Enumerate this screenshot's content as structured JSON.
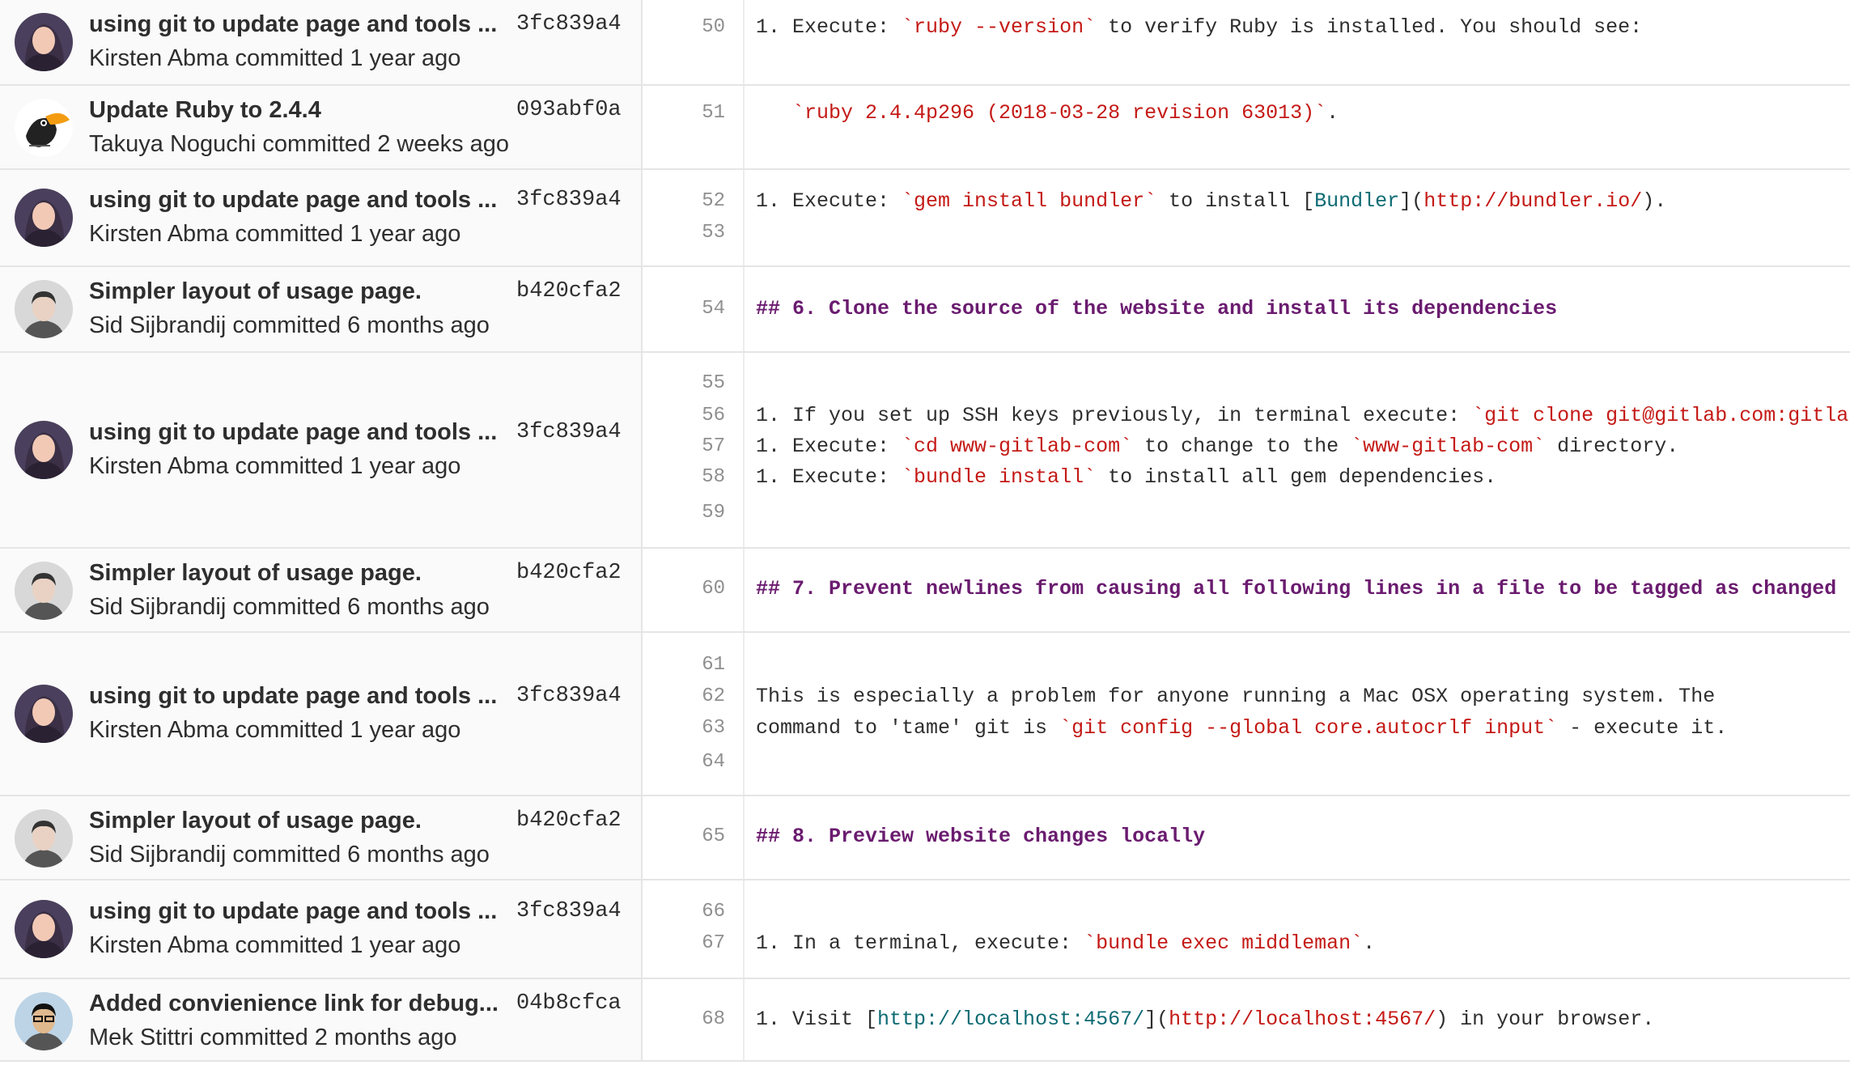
{
  "colors": {
    "text": "#2e2e2e",
    "line_number": "#8f8f8f",
    "string": "#c41a16",
    "link": "#0e6b74",
    "heading": "#6a1b6f",
    "commit_bg": "#fafafa",
    "border": "#e5e5e5"
  },
  "avatars": {
    "kirsten": {
      "icon": "avatar-woman-photo-icon",
      "bg": "#4a3f5c",
      "skin": "#f2c9b5",
      "hair": "#3a2f45"
    },
    "takuya": {
      "icon": "avatar-toucan-icon",
      "bg": "#ffffff",
      "beak": "#f39c12",
      "body": "#222222"
    },
    "sid": {
      "icon": "avatar-man-photo-icon",
      "bg": "#d8d8d8",
      "skin": "#e9d2c3",
      "hair": "#333333"
    },
    "mek": {
      "icon": "avatar-man-glasses-photo-icon",
      "bg": "#bcd4e6",
      "skin": "#e0b98e",
      "hair": "#111111"
    }
  },
  "blocks": [
    {
      "commit": {
        "title": "using git to update page and tools ...",
        "sha": "3fc839a4",
        "author": "Kirsten Abma",
        "committed": "committed",
        "time": "1 year ago",
        "avatar": "kirsten"
      },
      "lines": [
        {
          "no": "50",
          "tokens": [
            {
              "t": "plain",
              "s": "1. Execute: "
            },
            {
              "t": "str",
              "s": "`ruby --version`"
            },
            {
              "t": "plain",
              "s": " to verify Ruby is installed. You should see:"
            }
          ]
        }
      ]
    },
    {
      "commit": {
        "title": "Update Ruby to 2.4.4",
        "sha": "093abf0a",
        "author": "Takuya Noguchi",
        "committed": "committed",
        "time": "2 weeks ago",
        "avatar": "takuya"
      },
      "lines": [
        {
          "no": "51",
          "tokens": [
            {
              "t": "plain",
              "s": "   "
            },
            {
              "t": "str",
              "s": "`ruby 2.4.4p296 (2018-03-28 revision 63013)`"
            },
            {
              "t": "plain",
              "s": "."
            }
          ]
        }
      ]
    },
    {
      "commit": {
        "title": "using git to update page and tools ...",
        "sha": "3fc839a4",
        "author": "Kirsten Abma",
        "committed": "committed",
        "time": "1 year ago",
        "avatar": "kirsten"
      },
      "lines": [
        {
          "no": "52",
          "tokens": [
            {
              "t": "plain",
              "s": "1. Execute: "
            },
            {
              "t": "str",
              "s": "`gem install bundler`"
            },
            {
              "t": "plain",
              "s": " to install ["
            },
            {
              "t": "link",
              "s": "Bundler"
            },
            {
              "t": "plain",
              "s": "]("
            },
            {
              "t": "str",
              "s": "http://bundler.io/"
            },
            {
              "t": "plain",
              "s": ")."
            }
          ]
        },
        {
          "no": "53",
          "tokens": []
        }
      ]
    },
    {
      "commit": {
        "title": "Simpler layout of usage page.",
        "sha": "b420cfa2",
        "author": "Sid Sijbrandij",
        "committed": "committed",
        "time": "6 months ago",
        "avatar": "sid"
      },
      "lines": [
        {
          "no": "54",
          "tokens": [
            {
              "t": "head",
              "s": "## 6. Clone the source of the website and install its dependencies"
            }
          ]
        }
      ]
    },
    {
      "commit": {
        "title": "using git to update page and tools ...",
        "sha": "3fc839a4",
        "author": "Kirsten Abma",
        "committed": "committed",
        "time": "1 year ago",
        "avatar": "kirsten"
      },
      "lines": [
        {
          "no": "55",
          "tokens": []
        },
        {
          "no": "56",
          "tokens": [
            {
              "t": "plain",
              "s": "1. If you set up SSH keys previously, in terminal execute: "
            },
            {
              "t": "str",
              "s": "`git clone git@gitlab.com:gitlab-com/www-gitlab-com.git`"
            }
          ]
        },
        {
          "no": "57",
          "tokens": [
            {
              "t": "plain",
              "s": "1. Execute: "
            },
            {
              "t": "str",
              "s": "`cd www-gitlab-com`"
            },
            {
              "t": "plain",
              "s": " to change to the "
            },
            {
              "t": "str",
              "s": "`www-gitlab-com`"
            },
            {
              "t": "plain",
              "s": " directory."
            }
          ]
        },
        {
          "no": "58",
          "tokens": [
            {
              "t": "plain",
              "s": "1. Execute: "
            },
            {
              "t": "str",
              "s": "`bundle install`"
            },
            {
              "t": "plain",
              "s": " to install all gem dependencies."
            }
          ]
        },
        {
          "no": "59",
          "tokens": []
        }
      ]
    },
    {
      "commit": {
        "title": "Simpler layout of usage page.",
        "sha": "b420cfa2",
        "author": "Sid Sijbrandij",
        "committed": "committed",
        "time": "6 months ago",
        "avatar": "sid"
      },
      "lines": [
        {
          "no": "60",
          "tokens": [
            {
              "t": "head",
              "s": "## 7. Prevent newlines from causing all following lines in a file to be tagged as changed"
            }
          ]
        }
      ]
    },
    {
      "commit": {
        "title": "using git to update page and tools ...",
        "sha": "3fc839a4",
        "author": "Kirsten Abma",
        "committed": "committed",
        "time": "1 year ago",
        "avatar": "kirsten"
      },
      "lines": [
        {
          "no": "61",
          "tokens": []
        },
        {
          "no": "62",
          "tokens": [
            {
              "t": "plain",
              "s": "This is especially a problem for anyone running a Mac OSX operating system. The"
            }
          ]
        },
        {
          "no": "63",
          "tokens": [
            {
              "t": "plain",
              "s": "command to 'tame' git is "
            },
            {
              "t": "str",
              "s": "`git config --global core.autocrlf input`"
            },
            {
              "t": "plain",
              "s": " - execute it."
            }
          ]
        },
        {
          "no": "64",
          "tokens": []
        }
      ]
    },
    {
      "commit": {
        "title": "Simpler layout of usage page.",
        "sha": "b420cfa2",
        "author": "Sid Sijbrandij",
        "committed": "committed",
        "time": "6 months ago",
        "avatar": "sid"
      },
      "lines": [
        {
          "no": "65",
          "tokens": [
            {
              "t": "head",
              "s": "## 8. Preview website changes locally"
            }
          ]
        }
      ]
    },
    {
      "commit": {
        "title": "using git to update page and tools ...",
        "sha": "3fc839a4",
        "author": "Kirsten Abma",
        "committed": "committed",
        "time": "1 year ago",
        "avatar": "kirsten"
      },
      "lines": [
        {
          "no": "66",
          "tokens": []
        },
        {
          "no": "67",
          "tokens": [
            {
              "t": "plain",
              "s": "1. In a terminal, execute: "
            },
            {
              "t": "str",
              "s": "`bundle exec middleman`"
            },
            {
              "t": "plain",
              "s": "."
            }
          ]
        }
      ]
    },
    {
      "commit": {
        "title": "Added convienience link for debug...",
        "sha": "04b8cfca",
        "author": "Mek Stittri",
        "committed": "committed",
        "time": "2 months ago",
        "avatar": "mek"
      },
      "lines": [
        {
          "no": "68",
          "tokens": [
            {
              "t": "plain",
              "s": "1. Visit ["
            },
            {
              "t": "link",
              "s": "http://localhost:4567/"
            },
            {
              "t": "plain",
              "s": "]("
            },
            {
              "t": "str",
              "s": "http://localhost:4567/"
            },
            {
              "t": "plain",
              "s": ") in your browser."
            }
          ]
        }
      ]
    }
  ]
}
